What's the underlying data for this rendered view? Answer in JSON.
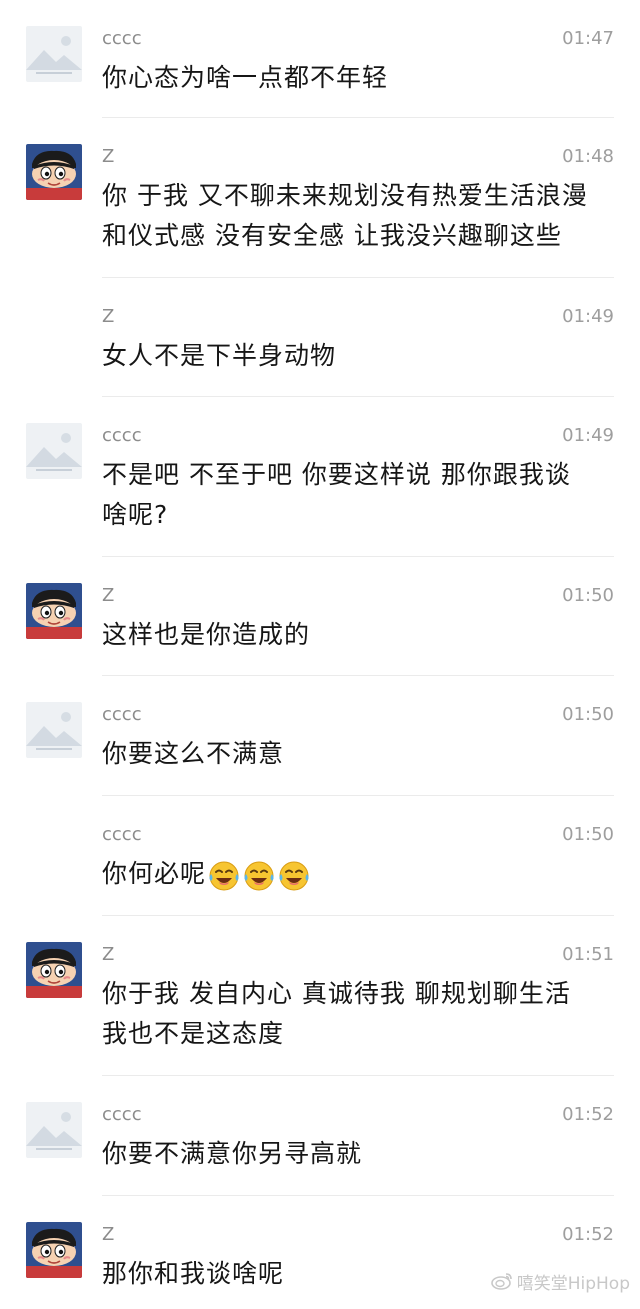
{
  "messages": [
    {
      "sender": "cccc",
      "avatar": "landscape-placeholder-icon",
      "time": "01:47",
      "text": "你心态为啥一点都不年轻"
    },
    {
      "sender": "Z",
      "avatar": "cartoon-boy-avatar",
      "time": "01:48",
      "text": "你 于我 又不聊未来规划没有热爱生活浪漫\n和仪式感 没有安全感 让我没兴趣聊这些"
    },
    {
      "sender": "Z",
      "avatar": "none",
      "time": "01:49",
      "text": "女人不是下半身动物"
    },
    {
      "sender": "cccc",
      "avatar": "landscape-placeholder-icon",
      "time": "01:49",
      "text": "不是吧 不至于吧 你要这样说 那你跟我谈\n啥呢?"
    },
    {
      "sender": "Z",
      "avatar": "cartoon-boy-avatar",
      "time": "01:50",
      "text": "这样也是你造成的"
    },
    {
      "sender": "cccc",
      "avatar": "landscape-placeholder-icon",
      "time": "01:50",
      "text": "你要这么不满意"
    },
    {
      "sender": "cccc",
      "avatar": "none",
      "time": "01:50",
      "text": "你何必呢",
      "emojis": [
        "crying-laughing-emoji",
        "crying-laughing-emoji",
        "crying-laughing-emoji"
      ]
    },
    {
      "sender": "Z",
      "avatar": "cartoon-boy-avatar",
      "time": "01:51",
      "text": "你于我 发自内心 真诚待我 聊规划聊生活\n我也不是这态度"
    },
    {
      "sender": "cccc",
      "avatar": "landscape-placeholder-icon",
      "time": "01:52",
      "text": "你要不满意你另寻高就"
    },
    {
      "sender": "Z",
      "avatar": "cartoon-boy-avatar",
      "time": "01:52",
      "text": "那你和我谈啥呢"
    }
  ],
  "watermark": {
    "text": "嘻笑堂HipHop",
    "icon": "weibo-icon"
  },
  "colors": {
    "text": "#161616",
    "meta": "#8c8c8c",
    "divider": "#ebebeb"
  }
}
